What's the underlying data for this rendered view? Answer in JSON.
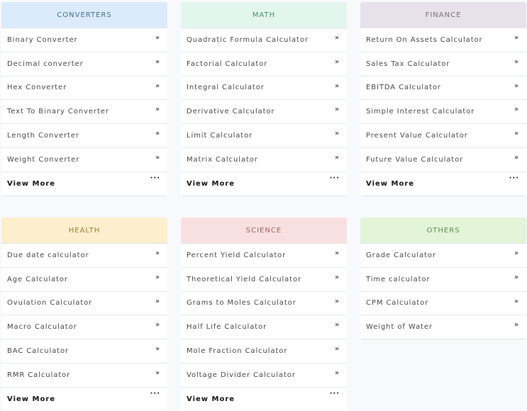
{
  "colors": {
    "converters": "#dcebfb",
    "math": "#e2f6ee",
    "finance": "#e6e1ea",
    "health": "#fdefcd",
    "science": "#f9e0e0",
    "others": "#e2f5d8"
  },
  "cards": [
    {
      "title": "CONVERTERS",
      "title_color": "#3d6d92",
      "items": [
        "Binary Converter",
        "Decimal converter",
        "Hex Converter",
        "Text To Binary Converter",
        "Length Converter",
        "Weight Converter"
      ],
      "more": "View More"
    },
    {
      "title": "MATH",
      "title_color": "#4e8a72",
      "items": [
        "Quadratic Formula Calculator",
        "Factorial Calculator",
        "Integral Calculator",
        "Derivative Calculator",
        "Limit Calculator",
        "Matrix Calculator"
      ],
      "more": "View More"
    },
    {
      "title": "FINANCE",
      "title_color": "#7a6d80",
      "items": [
        "Return On Assets Calculator",
        "Sales Tax Calculator",
        "EBITDA Calculator",
        "Simple Interest Calculator",
        "Present Value Calculator",
        "Future Value Calculator"
      ],
      "more": "View More"
    },
    {
      "title": "HEALTH",
      "title_color": "#9a7b35",
      "items": [
        "Due date calculator",
        "Age Calculator",
        "Ovulation Calculator",
        "Macro Calculator",
        "BAC Calculator",
        "RMR Calculator"
      ],
      "more": "View More"
    },
    {
      "title": "SCIENCE",
      "title_color": "#a45e5e",
      "items": [
        "Percent Yield Calculator",
        "Theoretical Yield Calculator",
        "Grams to Moles Calculator",
        "Half Life Calculator",
        "Mole Fraction Calculator",
        "Voltage Divider Calculator"
      ],
      "more": "View More"
    },
    {
      "title": "OTHERS",
      "title_color": "#5c8a4c",
      "items": [
        "Grade Calculator",
        "Time calculator",
        "CPM Calculator",
        "Weight of Water"
      ],
      "more": ""
    }
  ],
  "icons": {
    "chevron": "double-chevron-right-icon",
    "more": "ellipsis-icon"
  }
}
